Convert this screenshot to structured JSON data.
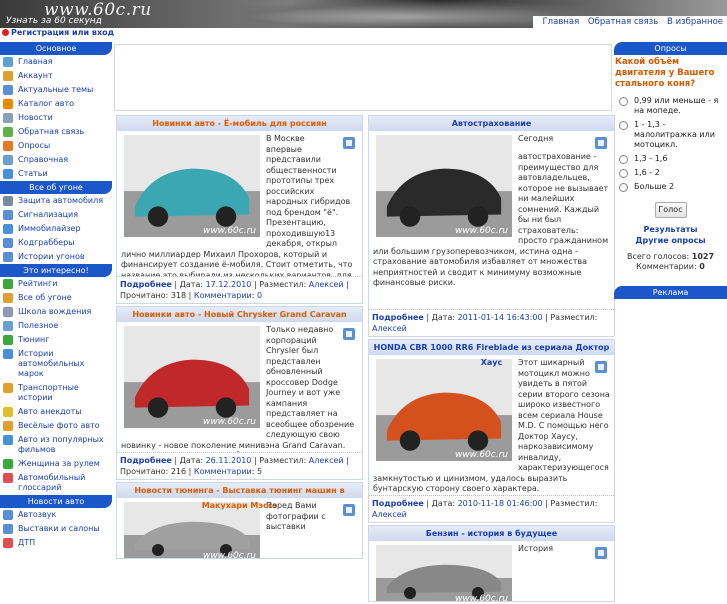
{
  "header": {
    "logo": "www.60c.ru",
    "slogan": "Узнать за 60 секунд",
    "nav": [
      "Главная",
      "Обратная связь",
      "В избранное"
    ]
  },
  "login": {
    "label": "Регистрация или вход"
  },
  "sidebar": {
    "sections": [
      {
        "title": "Основное",
        "items": [
          {
            "label": "Главная",
            "icon": "home-icon",
            "color": "#5fa0d8"
          },
          {
            "label": "Аккаунт",
            "icon": "user-icon",
            "color": "#e0a030"
          },
          {
            "label": "Актуальные темы",
            "icon": "topics-icon",
            "color": "#5a8fd6"
          },
          {
            "label": "Каталог авто",
            "icon": "catalog-icon",
            "color": "#f08a00"
          },
          {
            "label": "Новости",
            "icon": "news-icon",
            "color": "#8aa0b8"
          },
          {
            "label": "Обратная связь",
            "icon": "feedback-icon",
            "color": "#5fb04a"
          },
          {
            "label": "Опросы",
            "icon": "poll-icon",
            "color": "#e67a20"
          },
          {
            "label": "Справочная",
            "icon": "help-icon",
            "color": "#6aa0d0"
          },
          {
            "label": "Статьи",
            "icon": "articles-icon",
            "color": "#4a90d9"
          }
        ]
      },
      {
        "title": "Все об угоне",
        "items": [
          {
            "label": "Защита автомобиля",
            "icon": "shield-icon",
            "color": "#7a8aa0"
          },
          {
            "label": "Сигнализация",
            "icon": "alarm-icon",
            "color": "#5a8fd6"
          },
          {
            "label": "Иммобилайзер",
            "icon": "immobilizer-icon",
            "color": "#4a90d9"
          },
          {
            "label": "Кодграбберы",
            "icon": "codegrabber-icon",
            "color": "#5a8fd6"
          },
          {
            "label": "Истории угонов",
            "icon": "stories-icon",
            "color": "#5a8fd6"
          }
        ]
      },
      {
        "title": "Это интересно!",
        "items": [
          {
            "label": "Рейтинги",
            "icon": "ratings-icon",
            "color": "#3aa83a"
          },
          {
            "label": "Все об угоне",
            "icon": "theft-icon",
            "color": "#e0a030"
          },
          {
            "label": "Школа вождения",
            "icon": "school-icon",
            "color": "#8a9ab0"
          },
          {
            "label": "Полезное",
            "icon": "useful-icon",
            "color": "#6aa0d0"
          },
          {
            "label": "Тюнинг",
            "icon": "tuning-icon",
            "color": "#3aa83a"
          },
          {
            "label": "Истории автомобильных марок",
            "icon": "brands-icon",
            "color": "#4a90d9"
          },
          {
            "label": "Транспортные истории",
            "icon": "transport-icon",
            "color": "#e0a030"
          },
          {
            "label": "Авто анекдоты",
            "icon": "jokes-icon",
            "color": "#e0c030"
          },
          {
            "label": "Весёлые фото авто",
            "icon": "photo-icon",
            "color": "#e0a030"
          },
          {
            "label": "Авто из популярных фильмов",
            "icon": "films-icon",
            "color": "#4a90d9"
          },
          {
            "label": "Женщина за рулем",
            "icon": "woman-icon",
            "color": "#3aa83a"
          },
          {
            "label": "Автомобильный глоссарий",
            "icon": "glossary-icon",
            "color": "#e05050"
          }
        ]
      },
      {
        "title": "Новости авто",
        "items": [
          {
            "label": "Автозвук",
            "icon": "sound-icon",
            "color": "#5a8fd6"
          },
          {
            "label": "Выставки и салоны",
            "icon": "expo-icon",
            "color": "#5a8fd6"
          },
          {
            "label": "ДТП",
            "icon": "accident-icon",
            "color": "#e05050"
          }
        ]
      }
    ]
  },
  "articles_left": [
    {
      "title": "Новинки авто - Ё-мобиль для россиян",
      "title_style": "orange",
      "text": "В Москве впервые представили общественности прототипы трех российских народных гибридов под брендом \"ё\". Презентацию, проходившую13 декабря, открыл лично миллиардер Михаил Прохоров, который и финансирует создание ё-мобиля. Стоит отметить, что название это выбирали из нескольких вариантов, для чего был объявлен конкурс.",
      "more": "Подробнее",
      "date_label": "Дата:",
      "date": "17.12.2010",
      "author_label": "Разместил:",
      "author": "Алексей",
      "reads_label": "Прочитано:",
      "reads": "318",
      "comments_label": "Комментарии:",
      "comments": "0",
      "image_color": "#3aa7b3"
    },
    {
      "title": "Новинки авто - Новый Chrysker Grand Caravan",
      "title_style": "orange",
      "text": "Только недавно корпораций Chrysler был представлен обновленный кроссовер Dodge Journey и вот уже кампания представляет на всеобщее обозрение следующую свою новинку - новое поколение минивэна Grand Caravan. Grand Caravan один из наиболее продаваемых автомобилей этого класса в мире.",
      "more": "Подробнее",
      "date_label": "Дата:",
      "date": "26.11.2010",
      "author_label": "Разместил:",
      "author": "Алексей",
      "reads_label": "Прочитано:",
      "reads": "216",
      "comments_label": "Комментарии:",
      "comments": "5",
      "image_color": "#c0282a"
    },
    {
      "title": "Новости тюнинга - Выставка тюнинг машин в Макухари Мэссэ",
      "title_style": "orange",
      "text": "Перед Вами фотографии с выставки",
      "image_color": "#a0a0a0"
    }
  ],
  "articles_right": [
    {
      "title": "Автострахование",
      "title_style": "blue",
      "text": "Сегодня автострахование - преимущество для автовладельцев, которое не вызывает ни малейших сомнений. Каждый бы ни был страхователь: просто гражданином или большим грузоперевозчиком, истина одна - страхование автомобиля избавляет от множества неприятностей и сводит к минимуму возможные финансовые риски.",
      "more": "Подробнее",
      "date_label": "Дата:",
      "date": "2011-01-14 16:43:00",
      "author_label": "Разместил:",
      "author": "Алексей",
      "image_color": "#2a2a2a"
    },
    {
      "title": "HONDA CBR 1000 RR6 Fireblade из сериала Доктор Хаус",
      "title_style": "blue",
      "text": "Этот шикарный мотоцикл можно увидеть в пятой серии второго сезона широко известного всем сериала House M.D. С помощью него Доктор Хаусу, наркозависимому инвалиду, характеризующегося замкнутостью и цинизмом, удалось выразить бунтарскую сторону своего характера.",
      "more": "Подробнее",
      "date_label": "Дата:",
      "date": "2010-11-18 01:46:00",
      "author_label": "Разместил:",
      "author": "Алексей",
      "image_color": "#d4501c"
    },
    {
      "title": "Бензин - история в будущее",
      "title_style": "blue",
      "text": "История",
      "image_color": "#888888"
    }
  ],
  "poll": {
    "title": "Опросы",
    "question": "Какой объём двигателя у Вашего стального коня?",
    "options": [
      "0,99 или меньше - я на мопеде.",
      "1 - 1,3 - малолитражка или мотоцикл.",
      "1,3 - 1,6",
      "1,6 - 2",
      "Больше 2"
    ],
    "vote_button": "Голос",
    "results_link": "Результаты",
    "other_link": "Другие опросы",
    "total_label": "Всего голосов:",
    "total": "1027",
    "comments_label": "Комментарии:",
    "comments": "0"
  },
  "ads": {
    "title": "Реклама"
  }
}
